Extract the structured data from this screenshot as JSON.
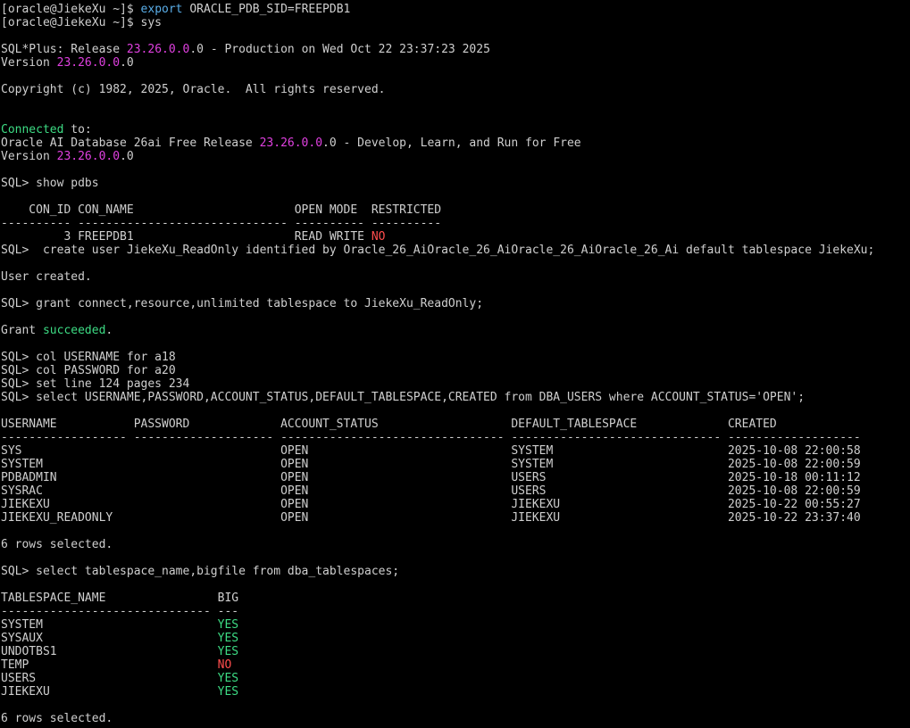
{
  "colors": {
    "background": "#000000",
    "default": "#cfcfcf",
    "number": "#e040e0",
    "keyword": "#5aaee8",
    "success": "#3ddc84",
    "error": "#ff4d4d"
  },
  "terminal": {
    "lines": [
      [
        {
          "t": "[oracle@JiekeXu ~]$ "
        },
        {
          "t": "export",
          "c": "keyword"
        },
        {
          "t": " ORACLE_PDB_SID=FREEPDB1"
        }
      ],
      [
        {
          "t": "[oracle@JiekeXu ~]$ sys"
        }
      ],
      [
        {
          "t": ""
        }
      ],
      [
        {
          "t": "SQL*Plus: Release "
        },
        {
          "t": "23.26.0.0",
          "c": "number"
        },
        {
          "t": ".0 - Production on Wed Oct 22 23:37:23 2025"
        }
      ],
      [
        {
          "t": "Version "
        },
        {
          "t": "23.26.0.0",
          "c": "number"
        },
        {
          "t": ".0"
        }
      ],
      [
        {
          "t": ""
        }
      ],
      [
        {
          "t": "Copyright (c) 1982, 2025, Oracle.  All rights reserved."
        }
      ],
      [
        {
          "t": ""
        }
      ],
      [
        {
          "t": ""
        }
      ],
      [
        {
          "t": "Connected",
          "c": "success"
        },
        {
          "t": " to:"
        }
      ],
      [
        {
          "t": "Oracle AI Database 26ai Free Release "
        },
        {
          "t": "23.26.0.0",
          "c": "number"
        },
        {
          "t": ".0 - Develop, Learn, and Run for Free"
        }
      ],
      [
        {
          "t": "Version "
        },
        {
          "t": "23.26.0.0",
          "c": "number"
        },
        {
          "t": ".0"
        }
      ],
      [
        {
          "t": ""
        }
      ],
      [
        {
          "t": "SQL> show pdbs"
        }
      ],
      [
        {
          "t": ""
        }
      ],
      [
        {
          "t": "    CON_ID CON_NAME                       OPEN MODE  RESTRICTED"
        }
      ],
      [
        {
          "t": "---------- ------------------------------ ---------- ----------"
        }
      ],
      [
        {
          "t": "         3 FREEPDB1                       READ WRITE "
        },
        {
          "t": "NO",
          "c": "error"
        }
      ],
      [
        {
          "t": "SQL>  create user JiekeXu_ReadOnly identified by Oracle_26_AiOracle_26_AiOracle_26_AiOracle_26_Ai default tablespace JiekeXu;"
        }
      ],
      [
        {
          "t": ""
        }
      ],
      [
        {
          "t": "User created."
        }
      ],
      [
        {
          "t": ""
        }
      ],
      [
        {
          "t": "SQL> grant connect,resource,unlimited tablespace to JiekeXu_ReadOnly;"
        }
      ],
      [
        {
          "t": ""
        }
      ],
      [
        {
          "t": "Grant "
        },
        {
          "t": "succeeded",
          "c": "success"
        },
        {
          "t": "."
        }
      ],
      [
        {
          "t": ""
        }
      ],
      [
        {
          "t": "SQL> col USERNAME for a18"
        }
      ],
      [
        {
          "t": "SQL> col PASSWORD for a20"
        }
      ],
      [
        {
          "t": "SQL> set line 124 pages 234"
        }
      ],
      [
        {
          "t": "SQL> select USERNAME,PASSWORD,ACCOUNT_STATUS,DEFAULT_TABLESPACE,CREATED from DBA_USERS where ACCOUNT_STATUS='OPEN';"
        }
      ],
      [
        {
          "t": ""
        }
      ],
      [
        {
          "t": "USERNAME           PASSWORD             ACCOUNT_STATUS                   DEFAULT_TABLESPACE             CREATED"
        }
      ],
      [
        {
          "t": "------------------ -------------------- -------------------------------- ------------------------------ -------------------"
        }
      ],
      [
        {
          "t": "SYS                                     OPEN                             SYSTEM                         2025-10-08 22:00:58"
        }
      ],
      [
        {
          "t": "SYSTEM                                  OPEN                             SYSTEM                         2025-10-08 22:00:59"
        }
      ],
      [
        {
          "t": "PDBADMIN                                OPEN                             USERS                          2025-10-18 00:11:12"
        }
      ],
      [
        {
          "t": "SYSRAC                                  OPEN                             USERS                          2025-10-08 22:00:59"
        }
      ],
      [
        {
          "t": "JIEKEXU                                 OPEN                             JIEKEXU                        2025-10-22 00:55:27"
        }
      ],
      [
        {
          "t": "JIEKEXU_READONLY                        OPEN                             JIEKEXU                        2025-10-22 23:37:40"
        }
      ],
      [
        {
          "t": ""
        }
      ],
      [
        {
          "t": "6 rows selected."
        }
      ],
      [
        {
          "t": ""
        }
      ],
      [
        {
          "t": "SQL> select tablespace_name,bigfile from dba_tablespaces;"
        }
      ],
      [
        {
          "t": ""
        }
      ],
      [
        {
          "t": "TABLESPACE_NAME                BIG"
        }
      ],
      [
        {
          "t": "------------------------------ ---"
        }
      ],
      [
        {
          "t": "SYSTEM                         "
        },
        {
          "t": "YES",
          "c": "success"
        }
      ],
      [
        {
          "t": "SYSAUX                         "
        },
        {
          "t": "YES",
          "c": "success"
        }
      ],
      [
        {
          "t": "UNDOTBS1                       "
        },
        {
          "t": "YES",
          "c": "success"
        }
      ],
      [
        {
          "t": "TEMP                           "
        },
        {
          "t": "NO",
          "c": "error"
        }
      ],
      [
        {
          "t": "USERS                          "
        },
        {
          "t": "YES",
          "c": "success"
        }
      ],
      [
        {
          "t": "JIEKEXU                        "
        },
        {
          "t": "YES",
          "c": "success"
        }
      ],
      [
        {
          "t": ""
        }
      ],
      [
        {
          "t": "6 rows selected."
        }
      ]
    ]
  }
}
